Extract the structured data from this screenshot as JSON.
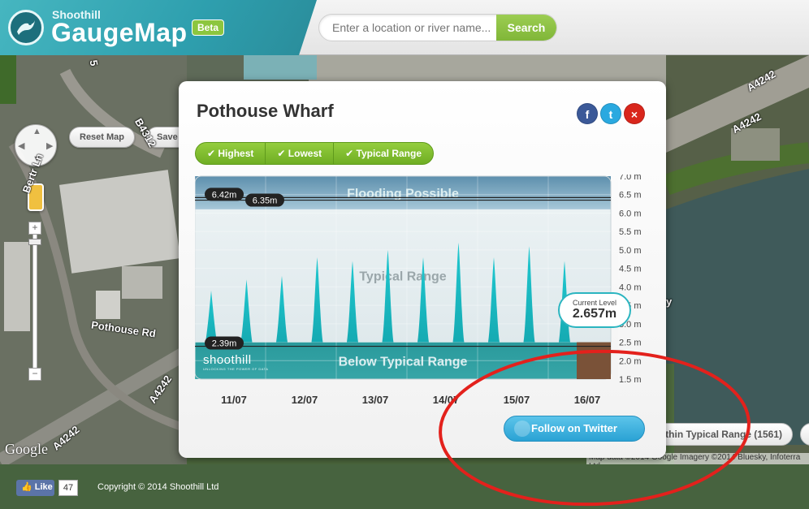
{
  "header": {
    "brand_small": "Shoothill",
    "brand_big": "GaugeMap",
    "beta": "Beta",
    "search_placeholder": "Enter a location or river name...",
    "search_button": "Search"
  },
  "map": {
    "reset_button": "Reset Map",
    "save_button": "Save vi",
    "google_logo": "Google",
    "attribution": "Map data ©2014 Google Imagery ©2014 Bluesky, Infoterra Ltd",
    "status_pill": "Within Typical Range (1561)",
    "road_labels": [
      "A4242",
      "A4242",
      "B4312",
      "Pothouse Rd",
      "A4242",
      "A4242",
      "Bertr Ln",
      "5",
      "y"
    ]
  },
  "popup": {
    "title": "Pothouse Wharf",
    "social": {
      "facebook": "f",
      "twitter": "t",
      "close": "×"
    },
    "filters": [
      "✔ Highest",
      "✔ Lowest",
      "✔ Typical Range"
    ],
    "follow_button": "Follow on Twitter",
    "chart": {
      "zones": {
        "top": "Flooding Possible",
        "middle": "Typical Range",
        "bottom": "Below Typical Range"
      },
      "markers": {
        "highest": "6.42m",
        "highest2": "6.35m",
        "lowest": "2.39m"
      },
      "current_level_label": "Current Level",
      "current_level_value": "2.657m",
      "brand": "shoothill",
      "brand_tag": "UNLOCKING THE POWER OF DATA"
    }
  },
  "chart_data": {
    "type": "area",
    "title": "Pothouse Wharf",
    "y_unit": "m",
    "ylim": [
      1.5,
      7.0
    ],
    "y_ticks": [
      "7.0 m",
      "6.5 m",
      "6.0 m",
      "5.5 m",
      "5.0 m",
      "4.5 m",
      "4.0 m",
      "3.5 m",
      "3.0 m",
      "2.5 m",
      "2.0 m",
      "1.5 m"
    ],
    "x_ticks": [
      "11/07",
      "12/07",
      "13/07",
      "14/07",
      "15/07",
      "16/07"
    ],
    "zones": [
      {
        "name": "Flooding Possible",
        "from": 6.1,
        "to": 7.0
      },
      {
        "name": "Typical Range",
        "from": 2.5,
        "to": 6.1
      },
      {
        "name": "Below Typical Range",
        "from": 1.5,
        "to": 2.5
      }
    ],
    "reference_lines": {
      "highest": 6.42,
      "highest2": 6.35,
      "lowest": 2.39
    },
    "tide_peaks": {
      "day": [
        0.0,
        0.5,
        1.0,
        1.5,
        2.0,
        2.5,
        3.0,
        3.5,
        4.0,
        4.5,
        5.0
      ],
      "level": [
        3.9,
        4.2,
        4.3,
        4.8,
        4.7,
        5.0,
        4.8,
        5.2,
        4.8,
        5.1,
        4.7
      ]
    },
    "baseline_level": 2.5,
    "current_level": 2.657
  },
  "footer": {
    "like": "Like",
    "like_count": "47",
    "copyright": "Copyright © 2014 Shoothill Ltd"
  }
}
